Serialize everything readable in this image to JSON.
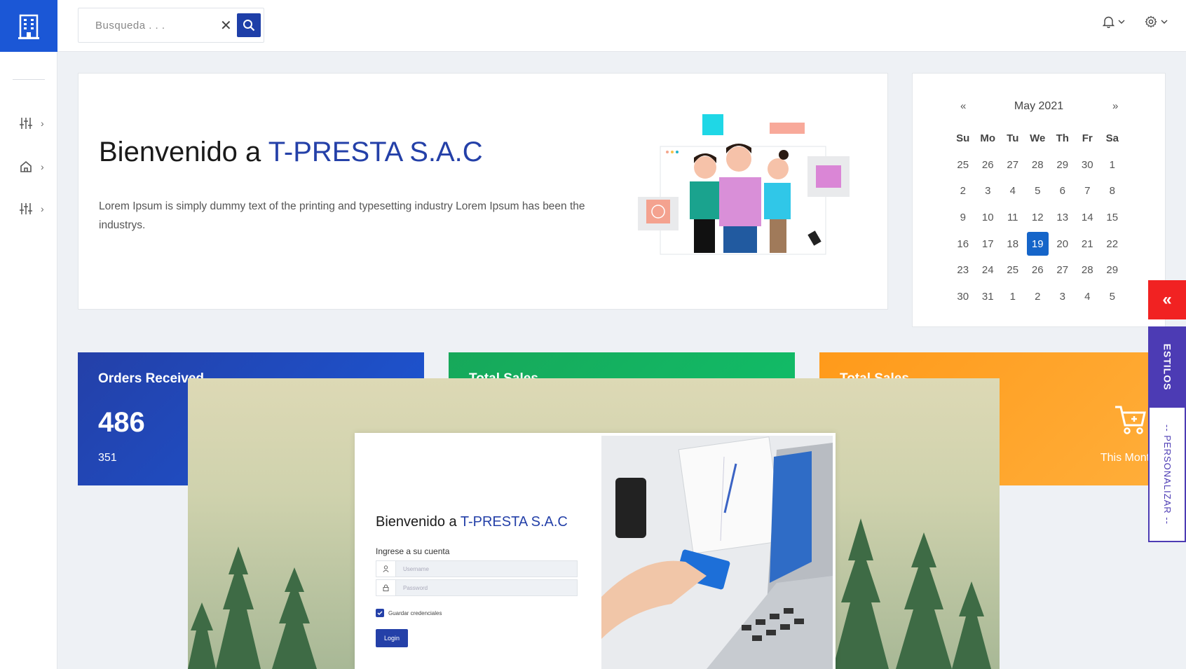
{
  "sidebar": {
    "items": [
      {
        "icon": "sliders-icon"
      },
      {
        "icon": "home-icon"
      },
      {
        "icon": "sliders-icon"
      }
    ]
  },
  "topbar": {
    "search_placeholder": "Busqueda . . ."
  },
  "welcome": {
    "title_prefix": "Bienvenido a ",
    "title_brand": "T-PRESTA S.A.C",
    "text": "Lorem Ipsum is simply dummy text of the printing and typesetting industry Lorem Ipsum has been the industrys."
  },
  "calendar": {
    "prev": "«",
    "next": "»",
    "title": "May 2021",
    "weekdays": [
      "Su",
      "Mo",
      "Tu",
      "We",
      "Th",
      "Fr",
      "Sa"
    ],
    "days": [
      "25",
      "26",
      "27",
      "28",
      "29",
      "30",
      "1",
      "2",
      "3",
      "4",
      "5",
      "6",
      "7",
      "8",
      "9",
      "10",
      "11",
      "12",
      "13",
      "14",
      "15",
      "16",
      "17",
      "18",
      "19",
      "20",
      "21",
      "22",
      "23",
      "24",
      "25",
      "26",
      "27",
      "28",
      "29",
      "30",
      "31",
      "1",
      "2",
      "3",
      "4",
      "5"
    ],
    "selected": "19"
  },
  "stats": {
    "orders": {
      "title": "Orders Received",
      "value": "486",
      "sub": "351"
    },
    "sales_green": {
      "title": "Total Sales"
    },
    "sales_orange": {
      "title": "Total Sales",
      "month_label": "This Month"
    }
  },
  "login": {
    "title_prefix": "Bienvenido a ",
    "title_brand": "T-PRESTA S.A.C",
    "subtitle": "Ingrese a su cuenta",
    "username_placeholder": "Username",
    "password_placeholder": "Password",
    "remember_label": "Guardar credenciales",
    "button_label": "Login"
  },
  "right_panel": {
    "toggle": "«",
    "estilos": "ESTILOS",
    "personalizar": "-- PERSONALIZAR --"
  },
  "colors": {
    "primary": "#2440a8",
    "accent_blue": "#1b57d6",
    "green": "#10c06a",
    "orange": "#ff9a1a",
    "red": "#f12222",
    "purple": "#4c3bb4"
  }
}
